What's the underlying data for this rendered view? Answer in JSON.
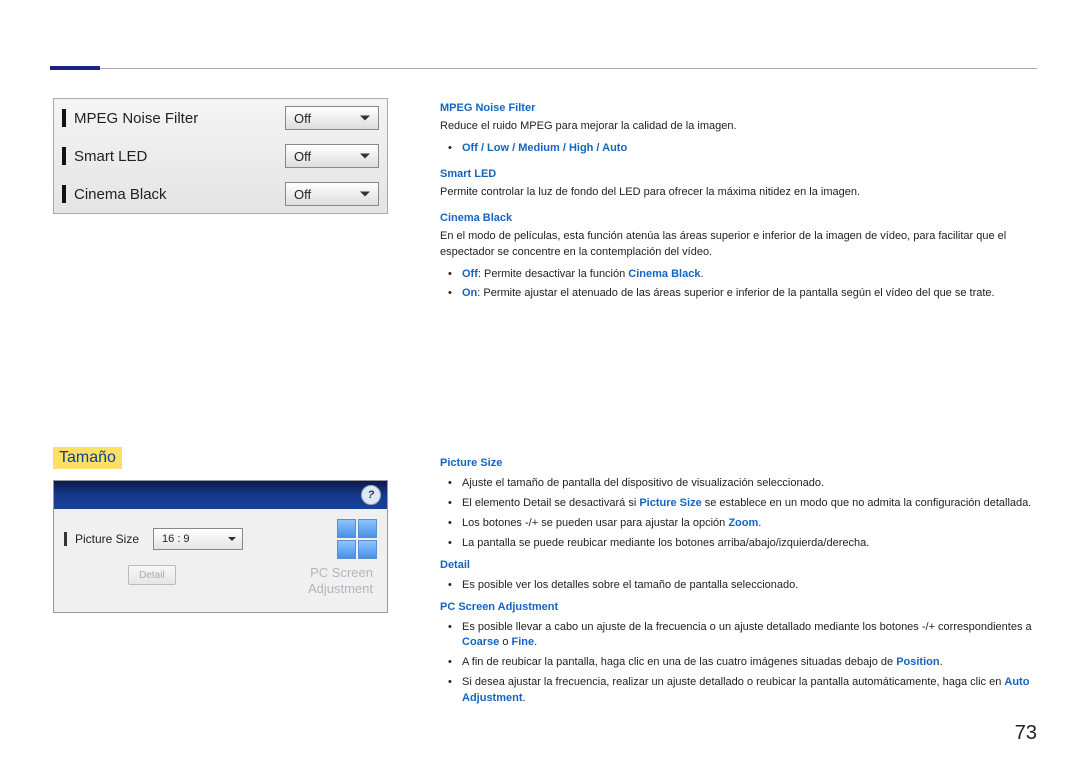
{
  "page_number": "73",
  "panel1": {
    "rows": [
      {
        "label": "MPEG Noise Filter",
        "value": "Off"
      },
      {
        "label": "Smart LED",
        "value": "Off"
      },
      {
        "label": "Cinema Black",
        "value": "Off"
      }
    ]
  },
  "section1": {
    "mpeg_title": "MPEG Noise Filter",
    "mpeg_desc": "Reduce el ruido MPEG para mejorar la calidad de la imagen.",
    "mpeg_options": "Off / Low / Medium / High / Auto",
    "smart_title": "Smart LED",
    "smart_desc": "Permite controlar la luz de fondo del LED para ofrecer la máxima nitidez en la imagen.",
    "cinema_title": "Cinema Black",
    "cinema_desc": "En el modo de películas, esta función atenúa las áreas superior e inferior de la imagen de vídeo, para facilitar que el espectador se concentre en la contemplación del vídeo.",
    "cinema_off_label": "Off",
    "cinema_off_text": ": Permite desactivar la función ",
    "cinema_off_ref": "Cinema Black",
    "cinema_on_label": "On",
    "cinema_on_text": ": Permite ajustar el atenuado de las áreas superior e inferior de la pantalla según el vídeo del que se trate."
  },
  "section_heading": "Tamaño",
  "panel2": {
    "help": "?",
    "label": "Picture Size",
    "value": "16 : 9",
    "detail_btn": "Detail",
    "ghost1": "PC Screen",
    "ghost2": "Adjustment"
  },
  "section2": {
    "ps_title": "Picture Size",
    "ps_b1": "Ajuste el tamaño de pantalla del dispositivo de visualización seleccionado.",
    "ps_b2a": "El elemento ",
    "ps_b2_detail": "Detail",
    "ps_b2b": " se desactivará si ",
    "ps_b2_ps": "Picture Size",
    "ps_b2c": " se establece en un modo que no admita la configuración detallada.",
    "ps_b3a": "Los botones -/+ se pueden usar para ajustar la opción ",
    "ps_b3_zoom": "Zoom",
    "ps_b3b": ".",
    "ps_b4": "La pantalla se puede reubicar mediante los botones arriba/abajo/izquierda/derecha.",
    "detail_title": "Detail",
    "detail_b1": "Es posible ver los detalles sobre el tamaño de pantalla seleccionado.",
    "pcsa_title": "PC Screen Adjustment",
    "pcsa_b1a": "Es posible llevar a cabo un ajuste de la frecuencia o un ajuste detallado mediante los botones -/+ correspondientes a ",
    "pcsa_b1_coarse": "Coarse",
    "pcsa_b1_or": " o ",
    "pcsa_b1_fine": "Fine",
    "pcsa_b1b": ".",
    "pcsa_b2a": "A fin de reubicar la pantalla, haga clic en una de las cuatro imágenes situadas debajo de ",
    "pcsa_b2_pos": "Position",
    "pcsa_b2b": ".",
    "pcsa_b3a": "Si desea ajustar la frecuencia, realizar un ajuste detallado o reubicar la pantalla automáticamente, haga clic en ",
    "pcsa_b3_auto": "Auto Adjustment",
    "pcsa_b3b": "."
  }
}
